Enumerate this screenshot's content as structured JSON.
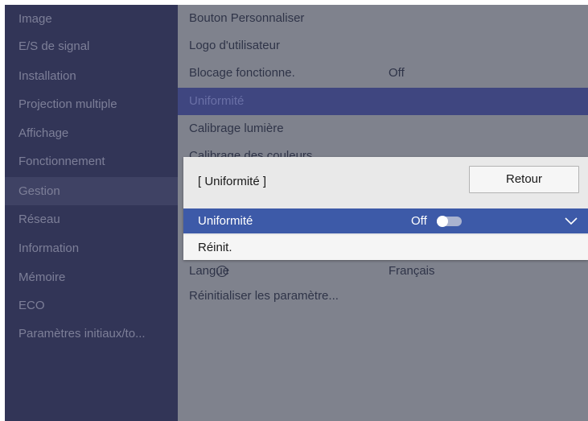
{
  "sidebar": {
    "items": [
      {
        "label": "Image"
      },
      {
        "label": "E/S de signal"
      },
      {
        "label": "Installation"
      },
      {
        "label": "Projection multiple"
      },
      {
        "label": "Affichage"
      },
      {
        "label": "Fonctionnement"
      },
      {
        "label": "Gestion",
        "selected": true
      },
      {
        "label": "Réseau"
      },
      {
        "label": "Information"
      },
      {
        "label": "Mémoire"
      },
      {
        "label": "ECO"
      },
      {
        "label": "Paramètres initiaux/to..."
      }
    ]
  },
  "main": {
    "items": [
      {
        "label": "Bouton Personnaliser"
      },
      {
        "label": "Logo d'utilisateur"
      },
      {
        "label": "Blocage fonctionne.",
        "value": "Off"
      },
      {
        "label": "Uniformité",
        "highlighted": true
      },
      {
        "label": "Calibrage lumière"
      },
      {
        "label": "Calibrage des couleurs"
      },
      {
        "label": "Langue",
        "value": "Français",
        "icon": "globe-icon"
      },
      {
        "label": "Réinitialiser les paramètre..."
      }
    ]
  },
  "dialog": {
    "title": "[ Uniformité ]",
    "back_label": "Retour",
    "options": [
      {
        "label": "Uniformité",
        "value": "Off",
        "toggle": false,
        "icon": "chevron-down-icon",
        "selected": true
      },
      {
        "label": "Réinit."
      }
    ]
  },
  "colors": {
    "sidebar_bg": "#323557",
    "main_bg": "#7f828d",
    "selected_option": "#3d5aa8",
    "dialog_bg": "#e9e9e9"
  }
}
